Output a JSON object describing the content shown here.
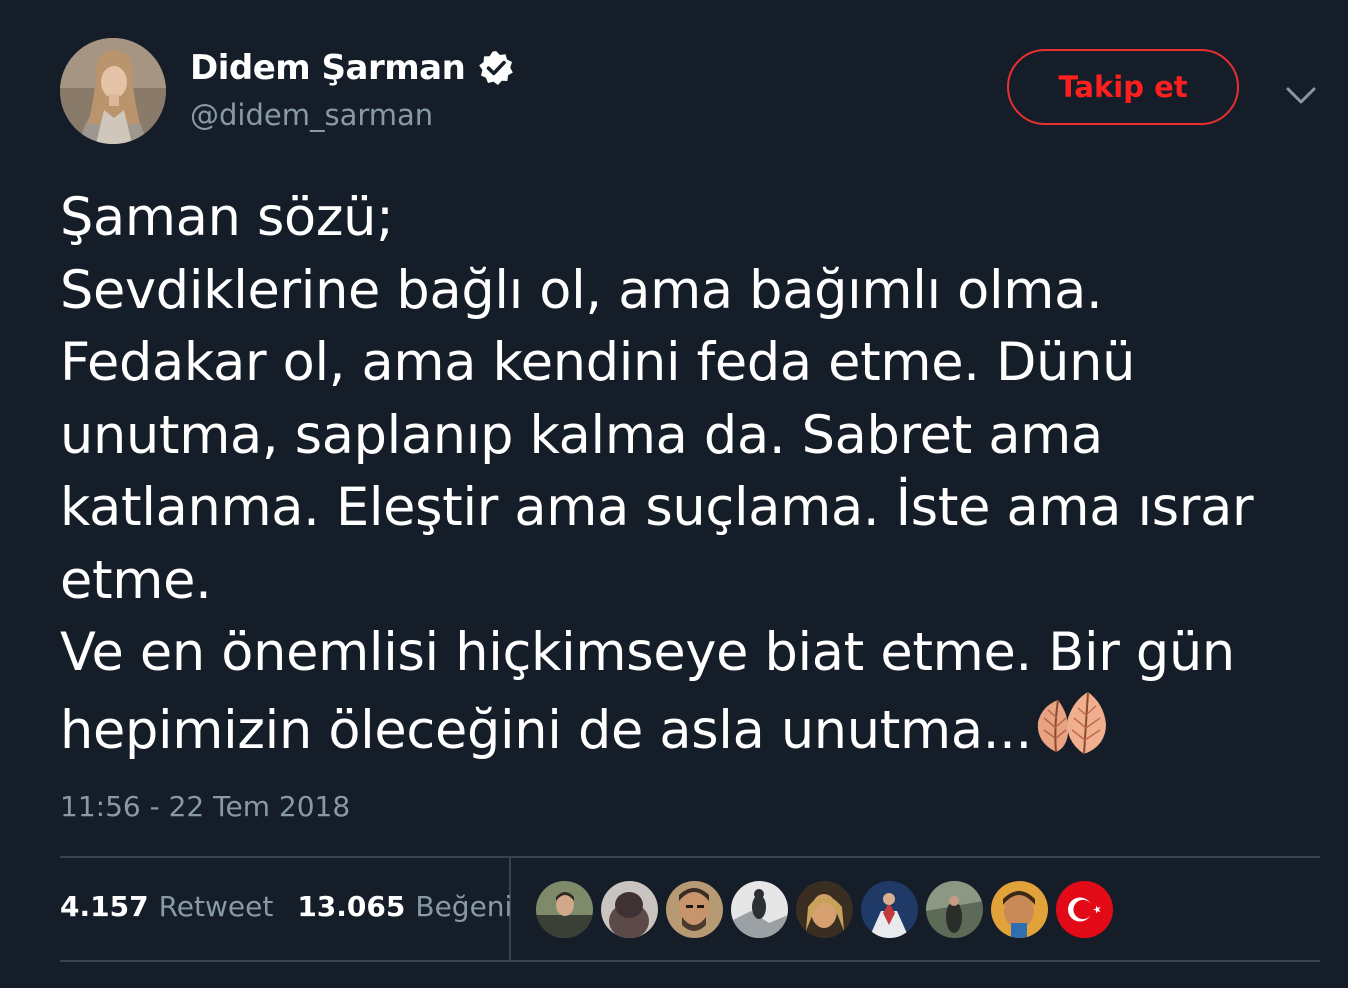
{
  "author": {
    "display_name": "Didem Şarman",
    "handle": "@didem_sarman",
    "verified": true,
    "verified_icon": "verified-badge-icon"
  },
  "follow_button": {
    "label": "Takip et",
    "color": "#ff1f1f"
  },
  "menu_icon": "chevron-down-icon",
  "tweet": {
    "text": "Şaman sözü;\nSevdiklerine bağlı ol, ama bağımlı olma.\nFedakar ol, ama kendini feda etme. Dünü\nunutma, saplanıp kalma da. Sabret ama\nkatlanma. Eleştir ama suçlama. İste ama ısrar\netme.\nVe en önemlisi hiçkimseye biat etme. Bir gün\nhepimizin öleceğini de asla unutma...",
    "emoji": "leaves-emoji",
    "timestamp": "11:56 - 22 Tem 2018"
  },
  "stats": {
    "retweet_count": "4.157",
    "retweet_label": "Retweet",
    "like_count": "13.065",
    "like_label": "Beğeni"
  },
  "likers": [
    {
      "name": "liker-avatar-1"
    },
    {
      "name": "liker-avatar-2"
    },
    {
      "name": "liker-avatar-3"
    },
    {
      "name": "liker-avatar-4"
    },
    {
      "name": "liker-avatar-5"
    },
    {
      "name": "liker-avatar-6"
    },
    {
      "name": "liker-avatar-7"
    },
    {
      "name": "liker-avatar-8"
    },
    {
      "name": "liker-avatar-9-turkish-flag"
    }
  ],
  "colors": {
    "background": "#151d29",
    "text": "#ffffff",
    "muted": "#8899a6",
    "divider": "#38444d",
    "accent": "#e0245e"
  }
}
